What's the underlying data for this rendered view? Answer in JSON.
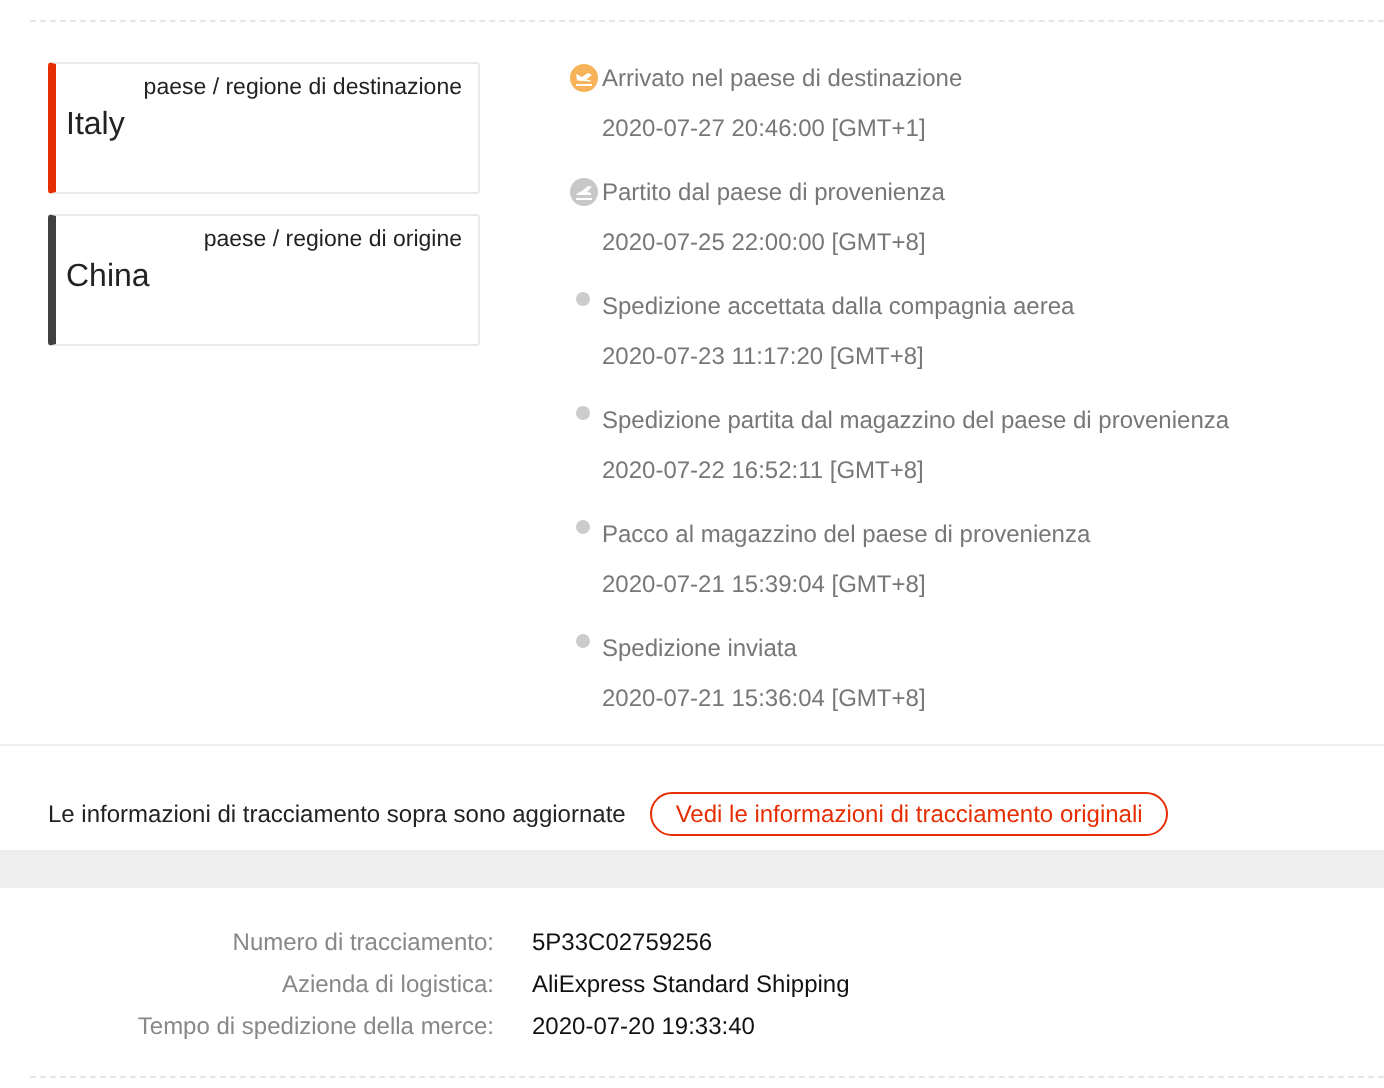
{
  "locations": [
    {
      "kind": "destination",
      "label": "paese / regione di destinazione",
      "country": "Italy"
    },
    {
      "kind": "origin",
      "label": "paese / regione di origine",
      "country": "China"
    }
  ],
  "events": [
    {
      "kind": "arrival",
      "title": "Arrivato nel paese di destinazione",
      "time": "2020-07-27 20:46:00 [GMT+1]"
    },
    {
      "kind": "departure",
      "title": "Partito dal paese di provenienza",
      "time": "2020-07-25 22:00:00 [GMT+8]"
    },
    {
      "kind": "step",
      "title": "Spedizione accettata dalla compagnia aerea",
      "time": "2020-07-23 11:17:20 [GMT+8]"
    },
    {
      "kind": "step",
      "title": "Spedizione partita dal magazzino del paese di provenienza",
      "time": "2020-07-22 16:52:11 [GMT+8]"
    },
    {
      "kind": "step",
      "title": "Pacco al magazzino del paese di provenienza",
      "time": "2020-07-21 15:39:04 [GMT+8]"
    },
    {
      "kind": "step",
      "title": "Spedizione inviata",
      "time": "2020-07-21 15:36:04 [GMT+8]"
    }
  ],
  "notice": {
    "text": "Le informazioni di tracciamento sopra sono aggiornate",
    "button": "Vedi le informazioni di tracciamento originali"
  },
  "details": [
    {
      "label": "Numero di tracciamento:",
      "value": "5P33C02759256"
    },
    {
      "label": "Azienda di logistica:",
      "value": "AliExpress Standard Shipping"
    },
    {
      "label": "Tempo di spedizione della merce:",
      "value": "2020-07-20 19:33:40"
    }
  ]
}
